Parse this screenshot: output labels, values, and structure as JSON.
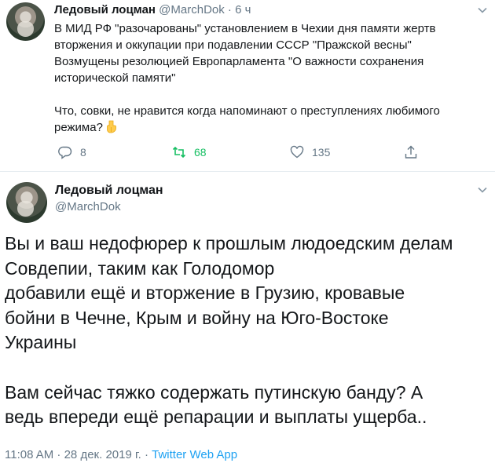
{
  "tweet1": {
    "author_name": "Ледовый лоцман",
    "author_handle": "@MarchDok",
    "separator": "·",
    "time_ago": "6 ч",
    "text_lines": [
      "В МИД РФ \"разочарованы\" установлением в Чехии дня памяти жертв",
      "вторжения и оккупации при подавлении СССР \"Пражской весны\"",
      " Возмущены резолюцией Европарламента \"О важности сохранения",
      "исторической памяти\"",
      "",
      "Что, совки, не нравится когда напоминают о преступлениях любимого",
      "режима?"
    ],
    "emoji": "hand-pointing-down-emoji",
    "replies": "8",
    "retweets": "68",
    "likes": "135",
    "retweet_active_color": "#17bf63"
  },
  "tweet2": {
    "author_name": "Ледовый лоцман",
    "author_handle": "@MarchDok",
    "text_lines": [
      "Вы и ваш недофюрер к прошлым людоедским делам",
      "Совдепии, таким как Голодомор",
      "добавили ещё и вторжение в Грузию, кровавые",
      "бойни в Чечне, Крым и войну на Юго-Востоке",
      "Украины",
      "",
      "Вам сейчас тяжко содержать путинскую банду? А",
      "ведь впереди ещё репарации и выплаты ущерба.."
    ],
    "timestamp": "11:08 AM · 28 дек. 2019 г. · ",
    "source_app": "Twitter Web App",
    "link_color": "#1da1f2"
  },
  "icons": {
    "reply": "reply-icon",
    "retweet": "retweet-icon",
    "like": "heart-icon",
    "share": "share-icon",
    "menu": "chevron-down-icon"
  }
}
